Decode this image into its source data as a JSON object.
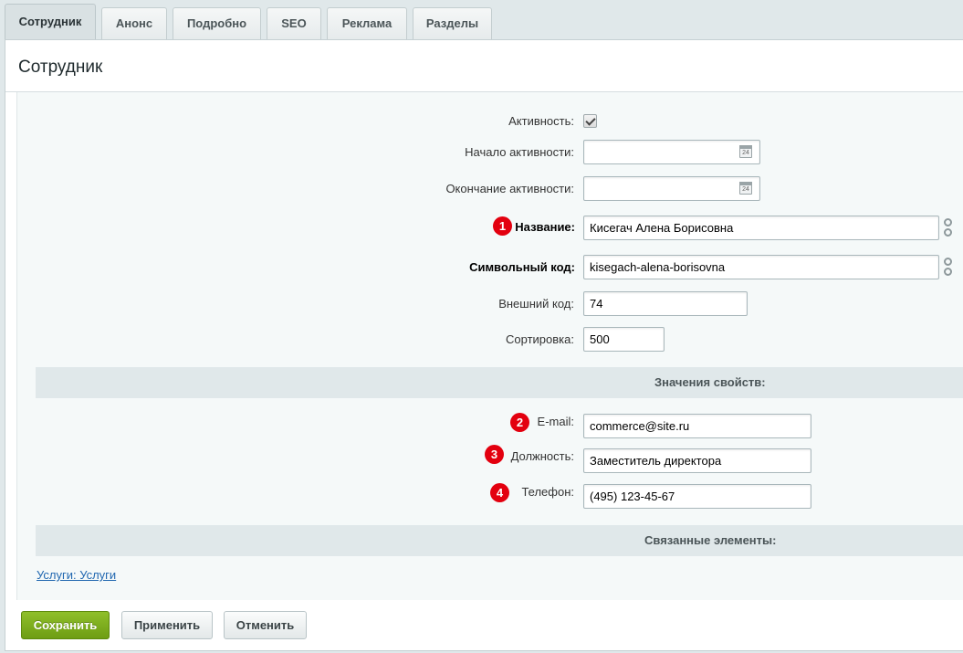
{
  "tabs": [
    {
      "label": "Сотрудник",
      "active": true
    },
    {
      "label": "Анонс"
    },
    {
      "label": "Подробно"
    },
    {
      "label": "SEO"
    },
    {
      "label": "Реклама"
    },
    {
      "label": "Разделы"
    }
  ],
  "title": "Сотрудник",
  "fields": {
    "active": {
      "label": "Активность:",
      "checked": true
    },
    "start": {
      "label": "Начало активности:",
      "value": "",
      "cal_day": "24"
    },
    "end": {
      "label": "Окончание активности:",
      "value": "",
      "cal_day": "24"
    },
    "name": {
      "label": "Название:",
      "value": "Кисегач Алена Борисовна",
      "badge": "1"
    },
    "code": {
      "label": "Символьный код:",
      "value": "kisegach-alena-borisovna"
    },
    "ext_code": {
      "label": "Внешний код:",
      "value": "74"
    },
    "sort": {
      "label": "Сортировка:",
      "value": "500"
    }
  },
  "properties": {
    "header": "Значения свойств:",
    "email": {
      "label": "E-mail:",
      "value": "commerce@site.ru",
      "badge": "2"
    },
    "position": {
      "label": "Должность:",
      "value": "Заместитель директора",
      "badge": "3"
    },
    "phone": {
      "label": "Телефон:",
      "value": "(495) 123-45-67",
      "badge": "4"
    }
  },
  "related": {
    "header": "Связанные элементы:",
    "link": "Услуги: Услуги"
  },
  "buttons": {
    "save": "Сохранить",
    "apply": "Применить",
    "cancel": "Отменить"
  },
  "colors": {
    "accent_green": "#7aab1c",
    "badge_red": "#e3000f",
    "link_blue": "#2067b0"
  }
}
